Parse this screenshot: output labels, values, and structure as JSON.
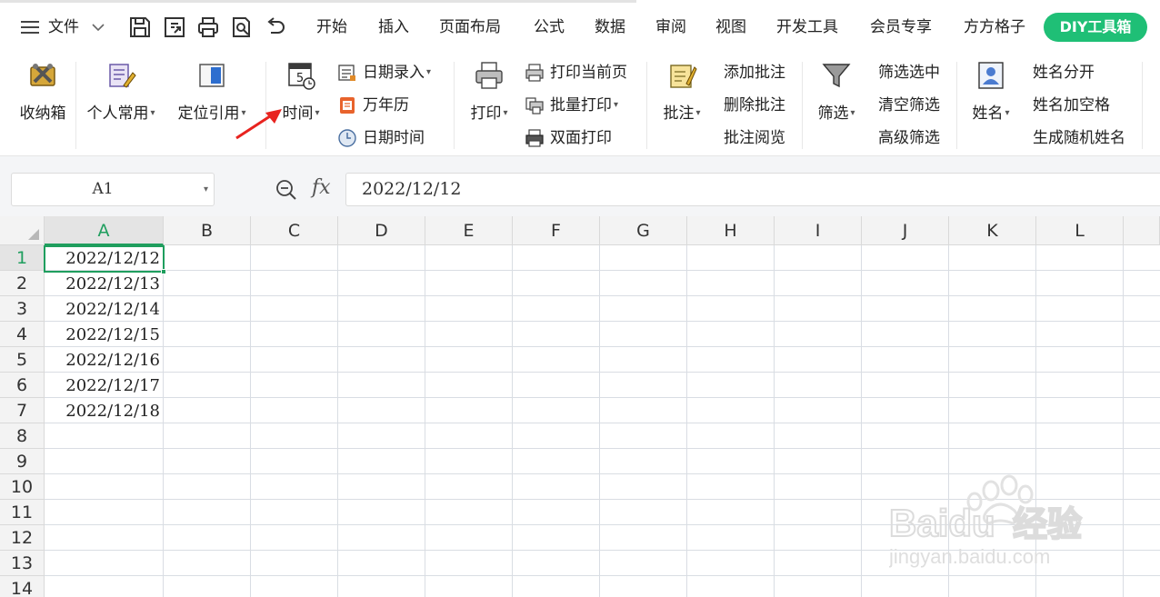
{
  "menubar": {
    "hamburger_label": "文件",
    "tabs": [
      "开始",
      "插入",
      "页面布局",
      "公式",
      "数据",
      "审阅",
      "视图",
      "开发工具",
      "会员专享",
      "方方格子"
    ],
    "diy_tab": "DIY工具箱",
    "accent": "#1fbf76"
  },
  "ribbon": {
    "storage_box": "收纳箱",
    "personal_common": "个人常用",
    "locate_ref": "定位引用",
    "time": "时间",
    "date_entry": "日期录入",
    "perpetual_calendar": "万年历",
    "date_time": "日期时间",
    "print": "打印",
    "print_current_page": "打印当前页",
    "batch_print": "批量打印",
    "duplex_print": "双面打印",
    "comment": "批注",
    "add_comment": "添加批注",
    "delete_comment": "删除批注",
    "read_comment": "批注阅览",
    "filter": "筛选",
    "filter_selected": "筛选选中",
    "clear_filter": "清空筛选",
    "advanced_filter": "高级筛选",
    "name": "姓名",
    "split_name": "姓名分开",
    "name_add_space": "姓名加空格",
    "random_name": "生成随机姓名"
  },
  "formula_bar": {
    "name_box": "A1",
    "fx_label": "fx",
    "formula_value": "2022/12/12"
  },
  "sheet": {
    "columns": [
      "A",
      "B",
      "C",
      "D",
      "E",
      "F",
      "G",
      "H",
      "I",
      "J",
      "K",
      "L"
    ],
    "rows": [
      "1",
      "2",
      "3",
      "4",
      "5",
      "6",
      "7",
      "8",
      "9",
      "10",
      "11",
      "12",
      "13",
      "14"
    ],
    "column_a_values": [
      "2022/12/12",
      "2022/12/13",
      "2022/12/14",
      "2022/12/15",
      "2022/12/16",
      "2022/12/17",
      "2022/12/18"
    ],
    "selected_cell": "A1",
    "selection_color": "#1f9e5e"
  },
  "watermark": {
    "brand": "Baidu",
    "brand_cn": "经验",
    "url": "jingyan.baidu.com"
  }
}
